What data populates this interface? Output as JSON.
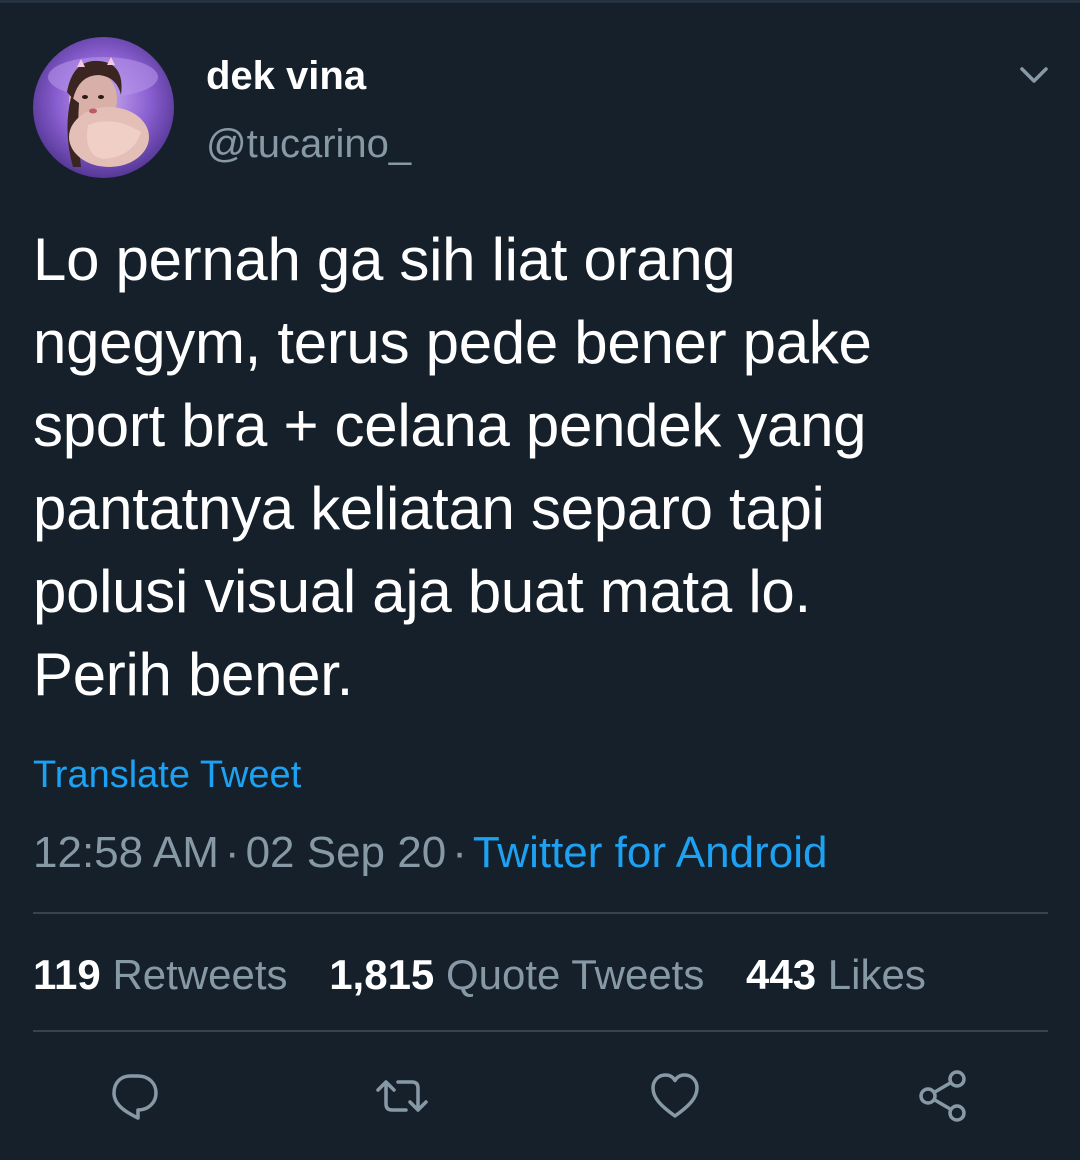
{
  "tweet": {
    "author": {
      "display_name": "dek vina",
      "handle": "@tucarino_"
    },
    "text": "Lo pernah ga sih liat orang\nngegym, terus pede bener pake\nsport bra + celana pendek yang\npantatnya keliatan separo tapi\npolusi visual aja buat mata lo.\nPerih bener.",
    "translate_label": "Translate Tweet",
    "time": "12:58 AM",
    "date": "02 Sep 20",
    "separator": "·",
    "source": "Twitter for Android"
  },
  "stats": [
    {
      "count": "119",
      "label": "Retweets"
    },
    {
      "count": "1,815",
      "label": "Quote Tweets"
    },
    {
      "count": "443",
      "label": "Likes"
    }
  ],
  "icons": {
    "more": "chevron-down-icon",
    "reply": "reply-icon",
    "retweet": "retweet-icon",
    "like": "heart-icon",
    "share": "share-icon"
  },
  "colors": {
    "background": "#15202b",
    "accent": "#1da1f2",
    "secondary_text": "#8899a6",
    "divider": "#38444d"
  }
}
